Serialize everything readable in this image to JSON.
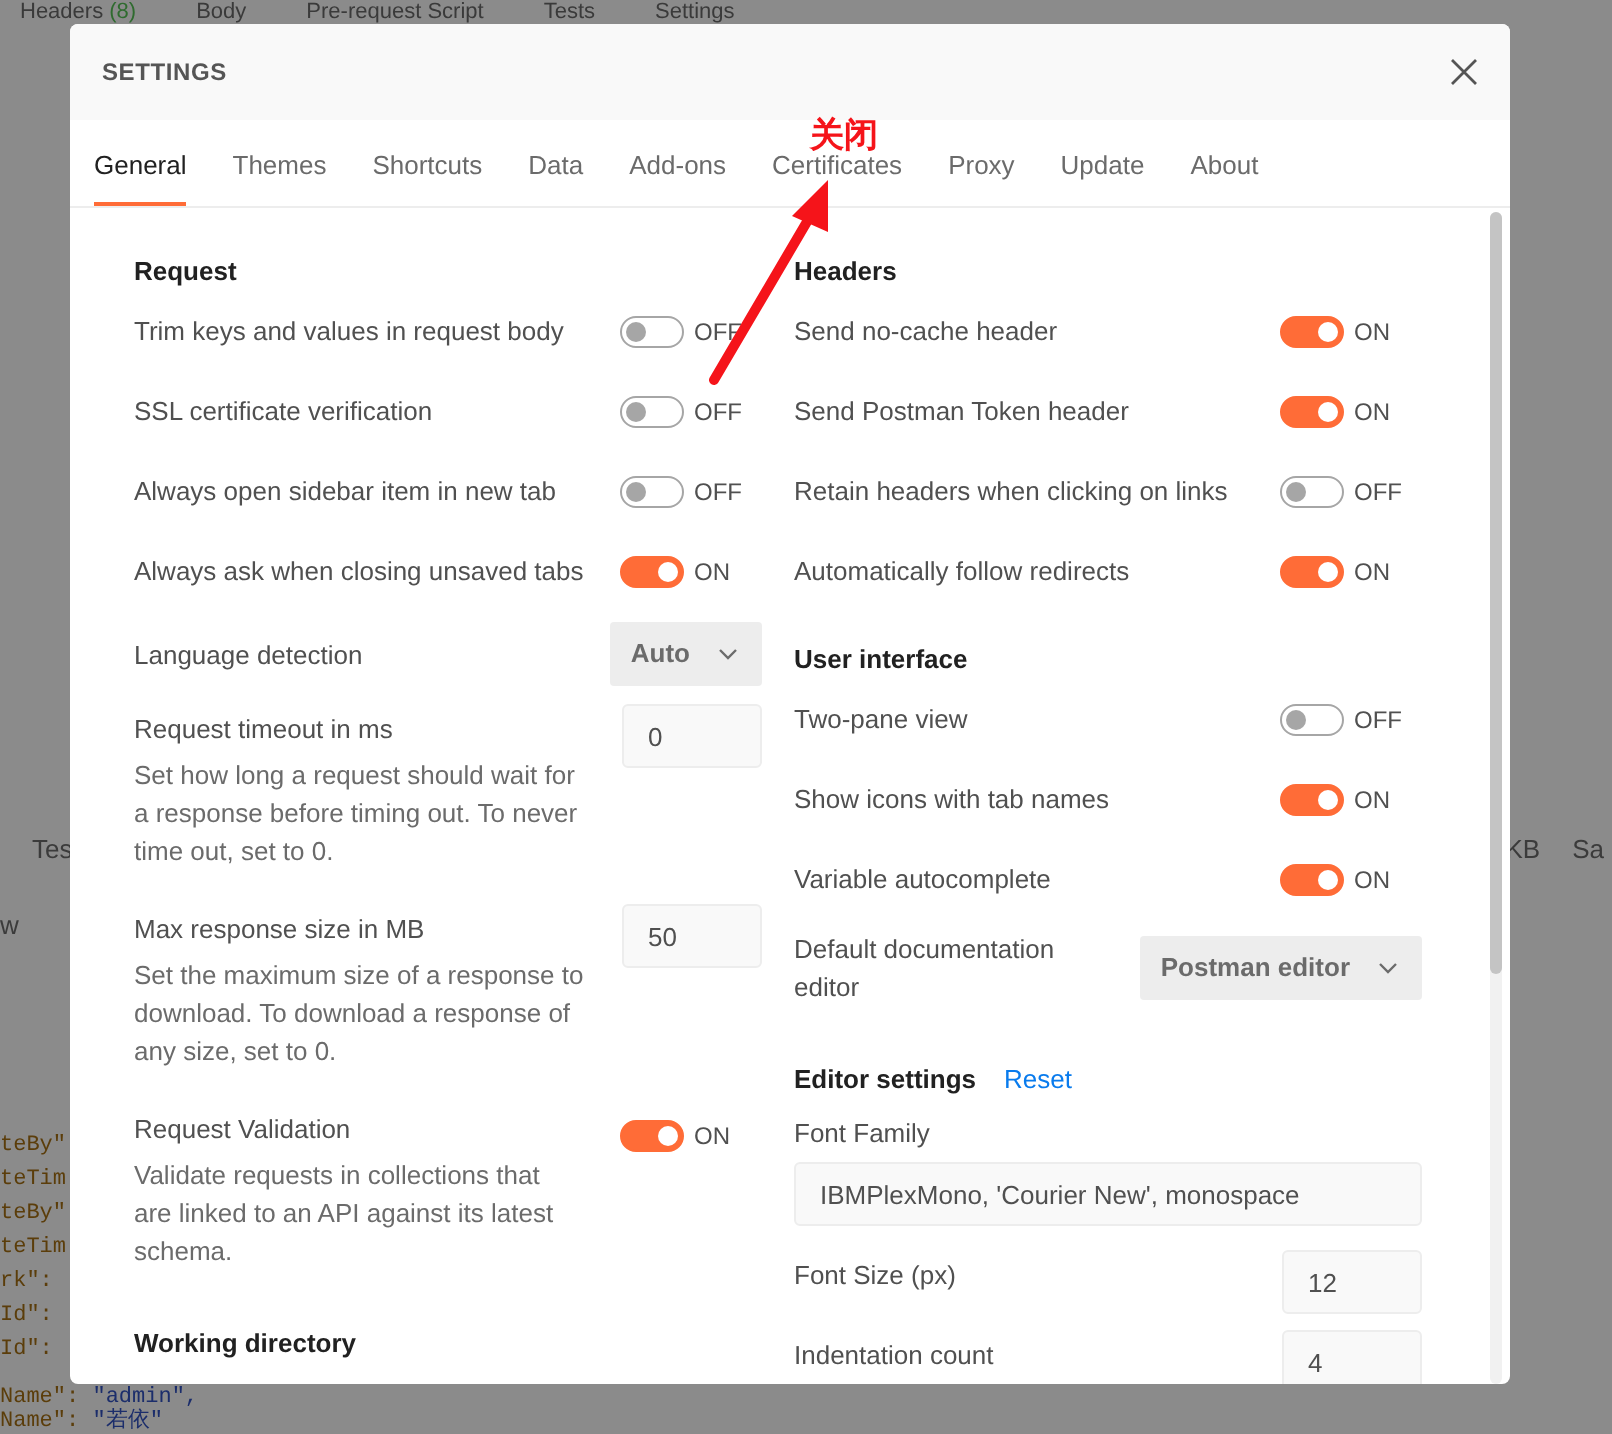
{
  "background": {
    "tabs": [
      {
        "label": "Headers",
        "count": "(8)"
      },
      {
        "label": "Body"
      },
      {
        "label": "Pre-request Script"
      },
      {
        "label": "Tests"
      },
      {
        "label": "Settings"
      }
    ],
    "left_texts": [
      "Tes",
      "w"
    ],
    "right_texts": [
      "KB",
      "Sa"
    ],
    "code_lines": [
      {
        "key": "teBy\""
      },
      {
        "key": "teTim"
      },
      {
        "key": "teBy\""
      },
      {
        "key": "teTim"
      },
      {
        "key": "rk\":"
      },
      {
        "key": "Id\":"
      },
      {
        "key": "Id\":"
      },
      {
        "key": "Name\":",
        "value": "\"admin\","
      },
      {
        "key": "Name\":",
        "value": "\"若依\""
      }
    ]
  },
  "dialog": {
    "title": "SETTINGS",
    "tabs": [
      {
        "label": "General",
        "selected": true
      },
      {
        "label": "Themes",
        "selected": false
      },
      {
        "label": "Shortcuts",
        "selected": false
      },
      {
        "label": "Data",
        "selected": false
      },
      {
        "label": "Add-ons",
        "selected": false
      },
      {
        "label": "Certificates",
        "selected": false
      },
      {
        "label": "Proxy",
        "selected": false
      },
      {
        "label": "Update",
        "selected": false
      },
      {
        "label": "About",
        "selected": false
      }
    ],
    "columns": [
      {
        "sections": [
          {
            "heading": "Request",
            "items": [
              {
                "kind": "toggle",
                "label": "Trim keys and values in request body",
                "on": false,
                "state_label": "OFF"
              },
              {
                "kind": "toggle",
                "label": "SSL certificate verification",
                "on": false,
                "state_label": "OFF"
              },
              {
                "kind": "toggle",
                "label": "Always open sidebar item in new tab",
                "on": false,
                "state_label": "OFF"
              },
              {
                "kind": "toggle",
                "label": "Always ask when closing unsaved tabs",
                "on": true,
                "state_label": "ON"
              },
              {
                "kind": "select",
                "label": "Language detection",
                "value": "Auto"
              },
              {
                "kind": "number",
                "label": "Request timeout in ms",
                "value": "0",
                "description": "Set how long a request should wait for a response before timing out. To never time out, set to 0."
              },
              {
                "kind": "number",
                "label": "Max response size in MB",
                "value": "50",
                "description": "Set the maximum size of a response to download. To download a response of any size, set to 0."
              },
              {
                "kind": "toggle",
                "label": "Request Validation",
                "on": true,
                "state_label": "ON",
                "description": "Validate requests in collections that are linked to an API against its latest schema."
              }
            ]
          },
          {
            "heading": "Working directory"
          }
        ]
      },
      {
        "sections": [
          {
            "heading": "Headers",
            "items": [
              {
                "kind": "toggle",
                "label": "Send no-cache header",
                "on": true,
                "state_label": "ON"
              },
              {
                "kind": "toggle",
                "label": "Send Postman Token header",
                "on": true,
                "state_label": "ON"
              },
              {
                "kind": "toggle",
                "label": "Retain headers when clicking on links",
                "on": false,
                "state_label": "OFF"
              },
              {
                "kind": "toggle",
                "label": "Automatically follow redirects",
                "on": true,
                "state_label": "ON"
              }
            ]
          },
          {
            "heading": "User interface",
            "items": [
              {
                "kind": "toggle",
                "label": "Two-pane view",
                "on": false,
                "state_label": "OFF"
              },
              {
                "kind": "toggle",
                "label": "Show icons with tab names",
                "on": true,
                "state_label": "ON"
              },
              {
                "kind": "toggle",
                "label": "Variable autocomplete",
                "on": true,
                "state_label": "ON"
              },
              {
                "kind": "select",
                "label": "Default documentation editor",
                "value": "Postman editor"
              }
            ]
          },
          {
            "heading": "Editor settings",
            "link": "Reset",
            "items": [
              {
                "kind": "text",
                "label": "Font Family",
                "value": "IBMPlexMono, 'Courier New', monospace"
              },
              {
                "kind": "number",
                "label": "Font Size (px)",
                "value": "12"
              },
              {
                "kind": "number",
                "label": "Indentation count",
                "value": "4"
              }
            ]
          }
        ]
      }
    ]
  },
  "annotation": {
    "text": "关闭"
  }
}
